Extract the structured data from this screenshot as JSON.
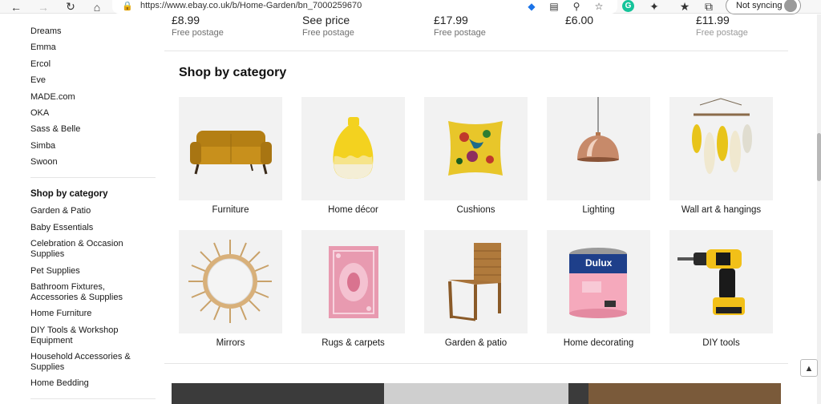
{
  "browser": {
    "url": "https://www.ebay.co.uk/b/Home-Garden/bn_7000259670",
    "sync_label": "Not syncing",
    "grammarly_letter": "G",
    "icons": [
      "back-icon",
      "forward-icon",
      "refresh-icon",
      "home-icon",
      "lock-icon",
      "tag-icon",
      "reader-icon",
      "zoom-icon",
      "favorite-add-icon",
      "grammarly-icon",
      "extensions-icon",
      "favorites-icon",
      "collections-icon",
      "avatar-icon"
    ]
  },
  "sidebar": {
    "brands": [
      "Dreams",
      "Emma",
      "Ercol",
      "Eve",
      "MADE.com",
      "OKA",
      "Sass & Belle",
      "Simba",
      "Swoon"
    ],
    "category_heading": "Shop by category",
    "categories": [
      "Garden & Patio",
      "Baby Essentials",
      "Celebration & Occasion Supplies",
      "Pet Supplies",
      "Bathroom Fixtures, Accessories & Supplies",
      "Home Furniture",
      "DIY Tools & Workshop Equipment",
      "Household Accessories & Supplies",
      "Home Bedding"
    ]
  },
  "top_products": [
    {
      "price": "£8.99",
      "postage": "Free postage"
    },
    {
      "price": "See price",
      "postage": "Free postage"
    },
    {
      "price": "£17.99",
      "postage": "Free postage"
    },
    {
      "price": "£6.00",
      "postage": ""
    },
    {
      "price": "£11.99",
      "postage": "Free postage"
    }
  ],
  "shop_by_category": {
    "title": "Shop by category",
    "items": [
      {
        "label": "Furniture",
        "icon": "sofa-icon"
      },
      {
        "label": "Home décor",
        "icon": "vase-icon"
      },
      {
        "label": "Cushions",
        "icon": "cushion-icon"
      },
      {
        "label": "Lighting",
        "icon": "pendant-lamp-icon"
      },
      {
        "label": "Wall art & hangings",
        "icon": "wall-hanging-icon"
      },
      {
        "label": "Mirrors",
        "icon": "mirror-icon"
      },
      {
        "label": "Rugs & carpets",
        "icon": "rug-icon"
      },
      {
        "label": "Garden & patio",
        "icon": "garden-chair-icon"
      },
      {
        "label": "Home decorating",
        "icon": "paint-tin-icon"
      },
      {
        "label": "DIY tools",
        "icon": "drill-icon"
      }
    ],
    "paint_brand": "Dulux"
  },
  "back_to_top_icon": "chevron-up-icon",
  "colors": {
    "sofa": "#c8901c",
    "vase_yellow": "#f3d21f",
    "cushion": "#e8c62a",
    "lamp": "#c78a6a",
    "rug": "#e89ab0",
    "paint_pink": "#f5a9bc",
    "drill": "#f2c018"
  }
}
